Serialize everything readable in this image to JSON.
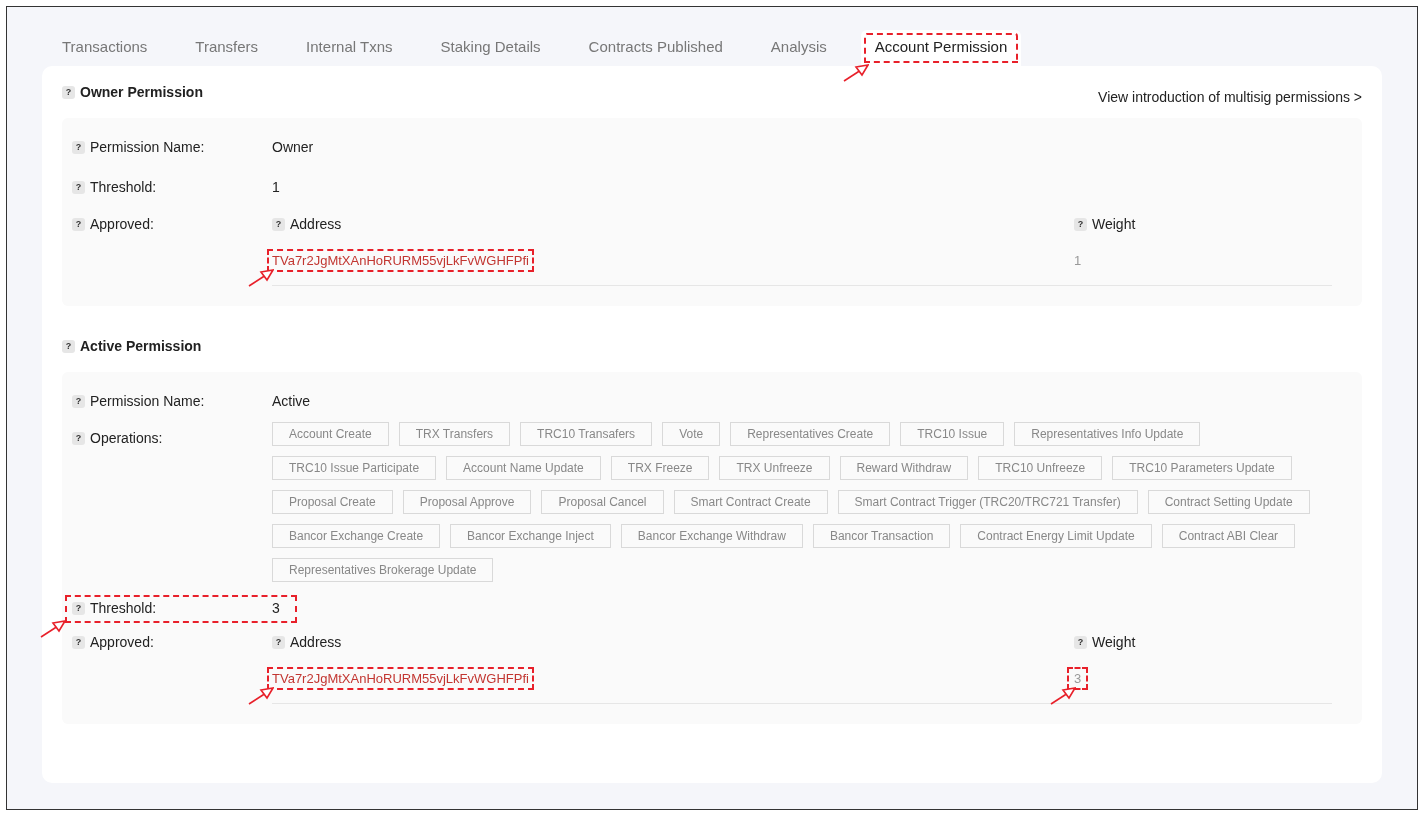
{
  "tabs": [
    {
      "label": "Transactions",
      "selected": false,
      "highlighted": false
    },
    {
      "label": "Transfers",
      "selected": false,
      "highlighted": false
    },
    {
      "label": "Internal Txns",
      "selected": false,
      "highlighted": false
    },
    {
      "label": "Staking Details",
      "selected": false,
      "highlighted": false
    },
    {
      "label": "Contracts Published",
      "selected": false,
      "highlighted": false
    },
    {
      "label": "Analysis",
      "selected": false,
      "highlighted": false
    },
    {
      "label": "Account Permission",
      "selected": true,
      "highlighted": true
    }
  ],
  "intro_link": "View introduction of multisig permissions >",
  "permissions": [
    {
      "help": "?",
      "title": "Owner Permission",
      "fields": [
        {
          "kind": "text",
          "help": "?",
          "label": "Permission Name:",
          "value": "Owner",
          "highlighted": false
        },
        {
          "kind": "text",
          "help": "?",
          "label": "Threshold:",
          "value": "1",
          "highlighted": false
        },
        {
          "kind": "approved",
          "help": "?",
          "label": "Approved:",
          "address_help": "?",
          "address_heading": "Address",
          "weight_help": "?",
          "weight_heading": "Weight",
          "rows": [
            {
              "address": "TVa7r2JgMtXAnHoRURM55vjLkFvWGHFPfi",
              "weight": "1",
              "address_highlighted": true,
              "weight_highlighted": false
            }
          ]
        }
      ]
    },
    {
      "help": "?",
      "title": "Active Permission",
      "fields": [
        {
          "kind": "text",
          "help": "?",
          "label": "Permission Name:",
          "value": "Active",
          "highlighted": false
        },
        {
          "kind": "operations",
          "help": "?",
          "label": "Operations:",
          "operations": [
            "Account Create",
            "TRX Transfers",
            "TRC10 Transafers",
            "Vote",
            "Representatives Create",
            "TRC10 Issue",
            "Representatives Info Update",
            "TRC10 Issue Participate",
            "Account Name Update",
            "TRX Freeze",
            "TRX Unfreeze",
            "Reward Withdraw",
            "TRC10 Unfreeze",
            "TRC10 Parameters Update",
            "Proposal Create",
            "Proposal Approve",
            "Proposal Cancel",
            "Smart Contract Create",
            "Smart Contract Trigger (TRC20/TRC721 Transfer)",
            "Contract Setting Update",
            "Bancor Exchange Create",
            "Bancor Exchange Inject",
            "Bancor Exchange Withdraw",
            "Bancor Transaction",
            "Contract Energy Limit Update",
            "Contract ABI Clear",
            "Representatives Brokerage Update"
          ]
        },
        {
          "kind": "text",
          "help": "?",
          "label": "Threshold:",
          "value": "3",
          "highlighted": true
        },
        {
          "kind": "approved",
          "help": "?",
          "label": "Approved:",
          "address_help": "?",
          "address_heading": "Address",
          "weight_help": "?",
          "weight_heading": "Weight",
          "rows": [
            {
              "address": "TVa7r2JgMtXAnHoRURM55vjLkFvWGHFPfi",
              "weight": "3",
              "address_highlighted": true,
              "weight_highlighted": true
            }
          ]
        }
      ]
    }
  ]
}
